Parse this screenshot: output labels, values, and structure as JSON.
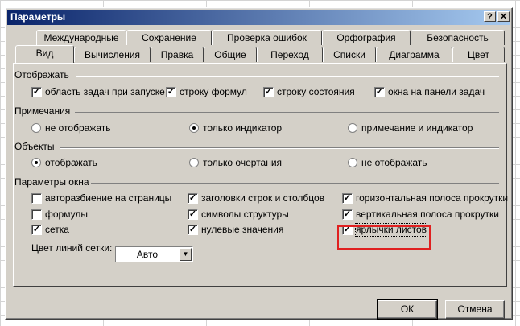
{
  "window": {
    "title": "Параметры",
    "help_glyph": "?",
    "close_glyph": "✕"
  },
  "tabs_back": [
    {
      "label": "Международные"
    },
    {
      "label": "Сохранение"
    },
    {
      "label": "Проверка ошибок"
    },
    {
      "label": "Орфография"
    },
    {
      "label": "Безопасность"
    }
  ],
  "tabs_front": [
    {
      "label": "Вид",
      "active": true
    },
    {
      "label": "Вычисления"
    },
    {
      "label": "Правка"
    },
    {
      "label": "Общие"
    },
    {
      "label": "Переход"
    },
    {
      "label": "Списки"
    },
    {
      "label": "Диаграмма"
    },
    {
      "label": "Цвет"
    }
  ],
  "show": {
    "title": "Отображать",
    "items": [
      {
        "label": "область задач при запуске",
        "checked": true
      },
      {
        "label": "строку формул",
        "checked": true
      },
      {
        "label": "строку состояния",
        "checked": true
      },
      {
        "label": "окна на панели задач",
        "checked": true
      }
    ]
  },
  "notes": {
    "title": "Примечания",
    "options": [
      {
        "label": "не отображать",
        "selected": false
      },
      {
        "label": "только индикатор",
        "selected": true
      },
      {
        "label": "примечание и индикатор",
        "selected": false
      }
    ]
  },
  "objects": {
    "title": "Объекты",
    "options": [
      {
        "label": "отображать",
        "selected": true
      },
      {
        "label": "только очертания",
        "selected": false
      },
      {
        "label": "не отображать",
        "selected": false
      }
    ]
  },
  "window_options": {
    "title": "Параметры окна",
    "items": [
      {
        "label": "авторазбиение на страницы",
        "checked": false
      },
      {
        "label": "заголовки строк и столбцов",
        "checked": true
      },
      {
        "label": "горизонтальная полоса прокрутки",
        "checked": true
      },
      {
        "label": "формулы",
        "checked": false
      },
      {
        "label": "символы структуры",
        "checked": true
      },
      {
        "label": "вертикальная полоса прокрутки",
        "checked": true
      },
      {
        "label": "сетка",
        "checked": true
      },
      {
        "label": "нулевые значения",
        "checked": true
      },
      {
        "label": "ярлычки листов",
        "checked": true
      }
    ],
    "grid_color_label": "Цвет линий сетки:",
    "grid_color_value": "Авто"
  },
  "buttons": {
    "ok": "ОК",
    "cancel": "Отмена"
  },
  "colors": {
    "highlight": "#e02020",
    "title_start": "#0a246a",
    "face": "#d4d0c8"
  }
}
